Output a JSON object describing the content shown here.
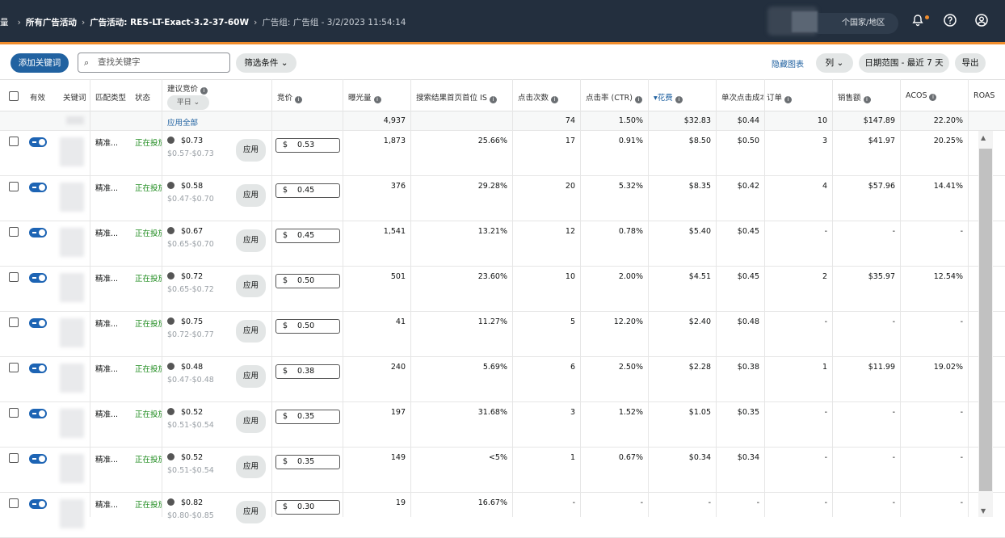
{
  "nav": {
    "cut_char": "量",
    "crumb1": "所有广告活动",
    "crumb2": "广告活动: RES-LT-Exact-3.2-37-60W",
    "crumb3": "广告组: 广告组 - 3/2/2023 11:54:14",
    "country": "个国家/地区",
    "icons": [
      "bell-icon",
      "help-icon",
      "account-icon"
    ]
  },
  "toolbar": {
    "add_keyword": "添加关键词",
    "search_placeholder": "查找关键字",
    "filter": "筛选条件",
    "hide_chart": "隐藏图表",
    "columns": "列",
    "date_range": "日期范围 - 最近 7 天",
    "export": "导出"
  },
  "table": {
    "headers": {
      "active": "有效",
      "keyword": "关键词",
      "match": "匹配类型",
      "status": "状态",
      "suggested": "建议竞价",
      "suggested_select": "平日",
      "bid": "竞价",
      "impressions": "曝光量",
      "top_is": "搜索结果首页首位 IS",
      "clicks": "点击次数",
      "ctr": "点击率 (CTR)",
      "spend": "花费",
      "cpc": "单次点击成本",
      "orders": "订单",
      "sales": "销售额",
      "acos": "ACOS",
      "roas": "ROAS"
    },
    "summary": {
      "apply_all": "应用全部",
      "impressions": "4,937",
      "clicks": "74",
      "ctr": "1.50%",
      "spend": "$32.83",
      "cpc": "$0.44",
      "orders": "10",
      "sales": "$147.89",
      "acos": "22.20%"
    },
    "apply_label": "应用",
    "currency": "$",
    "rows": [
      {
        "match": "精准...",
        "status": "正在投放",
        "sug": "$0.73",
        "range": "$0.57-$0.73",
        "bid": "0.53",
        "impr": "1,873",
        "is": "25.66%",
        "clicks": "17",
        "ctr": "0.91%",
        "spend": "$8.50",
        "cpc": "$0.50",
        "orders": "3",
        "sales": "$41.97",
        "acos": "20.25%"
      },
      {
        "match": "精准...",
        "status": "正在投放",
        "sug": "$0.58",
        "range": "$0.47-$0.70",
        "bid": "0.45",
        "impr": "376",
        "is": "29.28%",
        "clicks": "20",
        "ctr": "5.32%",
        "spend": "$8.35",
        "cpc": "$0.42",
        "orders": "4",
        "sales": "$57.96",
        "acos": "14.41%"
      },
      {
        "match": "精准...",
        "status": "正在投放",
        "sug": "$0.67",
        "range": "$0.65-$0.70",
        "bid": "0.45",
        "impr": "1,541",
        "is": "13.21%",
        "clicks": "12",
        "ctr": "0.78%",
        "spend": "$5.40",
        "cpc": "$0.45",
        "orders": "-",
        "sales": "-",
        "acos": "-"
      },
      {
        "match": "精准...",
        "status": "正在投放",
        "sug": "$0.72",
        "range": "$0.65-$0.72",
        "bid": "0.50",
        "impr": "501",
        "is": "23.60%",
        "clicks": "10",
        "ctr": "2.00%",
        "spend": "$4.51",
        "cpc": "$0.45",
        "orders": "2",
        "sales": "$35.97",
        "acos": "12.54%"
      },
      {
        "match": "精准...",
        "status": "正在投放",
        "sug": "$0.75",
        "range": "$0.72-$0.77",
        "bid": "0.50",
        "impr": "41",
        "is": "11.27%",
        "clicks": "5",
        "ctr": "12.20%",
        "spend": "$2.40",
        "cpc": "$0.48",
        "orders": "-",
        "sales": "-",
        "acos": "-"
      },
      {
        "match": "精准...",
        "status": "正在投放",
        "sug": "$0.48",
        "range": "$0.47-$0.48",
        "bid": "0.38",
        "impr": "240",
        "is": "5.69%",
        "clicks": "6",
        "ctr": "2.50%",
        "spend": "$2.28",
        "cpc": "$0.38",
        "orders": "1",
        "sales": "$11.99",
        "acos": "19.02%"
      },
      {
        "match": "精准...",
        "status": "正在投放",
        "sug": "$0.52",
        "range": "$0.51-$0.54",
        "bid": "0.35",
        "impr": "197",
        "is": "31.68%",
        "clicks": "3",
        "ctr": "1.52%",
        "spend": "$1.05",
        "cpc": "$0.35",
        "orders": "-",
        "sales": "-",
        "acos": "-"
      },
      {
        "match": "精准...",
        "status": "正在投放",
        "sug": "$0.52",
        "range": "$0.51-$0.54",
        "bid": "0.35",
        "impr": "149",
        "is": "<5%",
        "clicks": "1",
        "ctr": "0.67%",
        "spend": "$0.34",
        "cpc": "$0.34",
        "orders": "-",
        "sales": "-",
        "acos": "-"
      },
      {
        "match": "精准...",
        "status": "正在投放",
        "sug": "$0.82",
        "range": "$0.80-$0.85",
        "bid": "0.30",
        "impr": "19",
        "is": "16.67%",
        "clicks": "-",
        "ctr": "-",
        "spend": "-",
        "cpc": "-",
        "orders": "-",
        "sales": "-",
        "acos": "-"
      }
    ]
  },
  "colors": {
    "nav_bg": "#232f3e",
    "accent_orange": "#f08c2c",
    "primary_blue": "#2162a1",
    "status_green": "#1c8a1c"
  }
}
